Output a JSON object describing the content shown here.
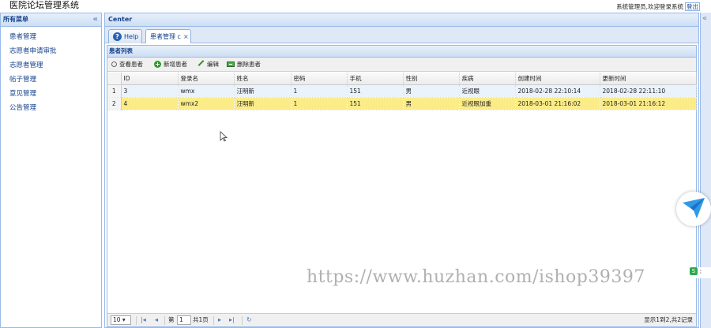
{
  "app": {
    "title": "医院论坛管理系统"
  },
  "user_bar": {
    "greeting": "系统管理员,欢迎登录系统",
    "logout": "登出"
  },
  "west": {
    "title": "所有菜单",
    "collapse_icon": "«",
    "items": [
      {
        "label": "患者管理"
      },
      {
        "label": "志愿者申请审批"
      },
      {
        "label": "志愿者管理"
      },
      {
        "label": "帖子管理"
      },
      {
        "label": "意见管理"
      },
      {
        "label": "公告管理"
      }
    ]
  },
  "center": {
    "title": "Center",
    "tabs": [
      {
        "label": "Help",
        "icon": "help-icon"
      },
      {
        "label": "患者管理",
        "icon": "close-icon",
        "marker": "c"
      }
    ],
    "grid": {
      "title": "患者列表",
      "toolbar": {
        "search": "查看患者",
        "add": "新增患者",
        "edit": "编辑",
        "remove": "删除患者"
      },
      "columns": [
        "ID",
        "登录名",
        "姓名",
        "密码",
        "手机",
        "性别",
        "疾病",
        "创建时间",
        "更新时间"
      ],
      "rows": [
        {
          "rownum": "1",
          "cells": [
            "3",
            "wmx",
            "汪明新",
            "1",
            "151",
            "男",
            "近视眼",
            "2018-02-28 22:10:14",
            "2018-02-28 22:11:10"
          ]
        },
        {
          "rownum": "2",
          "cells": [
            "4",
            "wmx2",
            "汪明新",
            "1",
            "151",
            "男",
            "近视眼加重",
            "2018-03-01 21:16:02",
            "2018-03-01 21:16:12"
          ]
        }
      ],
      "selected_row": 1,
      "pager": {
        "page_size": "10 ▾",
        "before_page": "第",
        "page": "1",
        "after_page": "共1页",
        "info": "显示1到2,共2记录"
      }
    }
  },
  "east": {
    "collapse_icon": "«"
  },
  "watermark": "https://www.huzhan.com/ishop39397",
  "colors": {
    "border": "#99bbe8",
    "header_text": "#15428b",
    "selected_row": "#fbec88",
    "alt_row": "#eaf2fb"
  }
}
